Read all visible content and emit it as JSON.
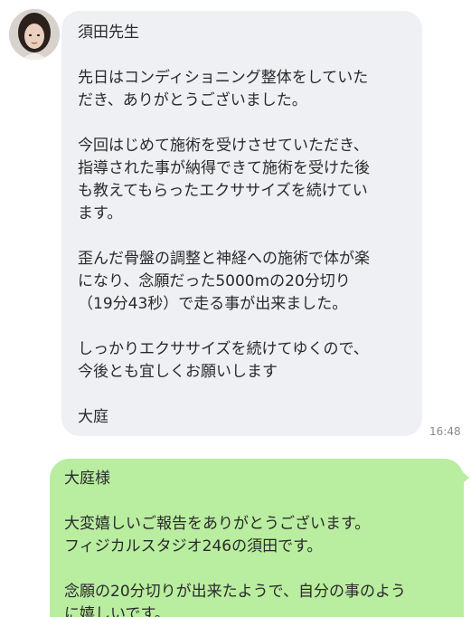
{
  "chat": {
    "avatar": "profile-photo-woman",
    "incoming": {
      "lines": [
        "須田先生",
        "",
        "先日はコンディショニング整体をしていた",
        "だき、ありがとうございました。",
        "",
        "今回はじめて施術を受けさせていただき、",
        "指導された事が納得できて施術を受けた後",
        "も教えてもらったエクササイズを続けてい",
        "ます。",
        "",
        "歪んだ骨盤の調整と神経への施術で体が楽",
        "になり、念願だった5000mの20分切り",
        "（19分43秒）で走る事が出来ました。",
        "",
        "しっかりエクササイズを続けてゆくので、",
        "今後とも宜しくお願いします",
        "",
        "大庭"
      ],
      "time": "16:48"
    },
    "outgoing": {
      "lines": [
        "大庭様",
        "",
        "大変嬉しいご報告をありがとうございます。",
        "フィジカルスタジオ246の須田です。",
        "",
        "念願の20分切りが出来たようで、自分の事のよう",
        "に嬉しいです。"
      ]
    },
    "colors": {
      "incoming_bubble": "#eef0f3",
      "outgoing_bubble": "#b9eda0",
      "text": "#2a2a2a",
      "time": "#8a8a8a"
    }
  }
}
